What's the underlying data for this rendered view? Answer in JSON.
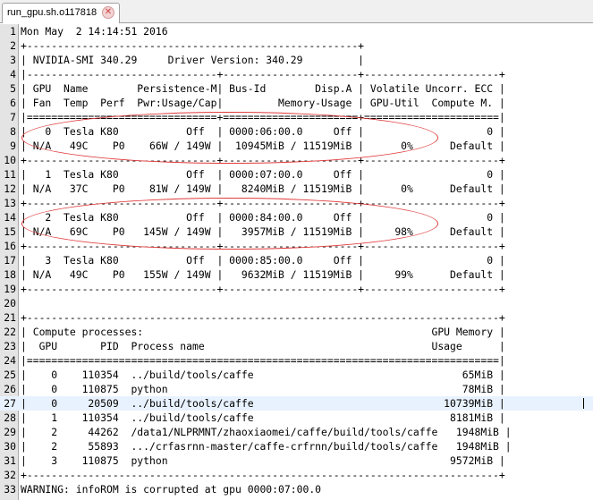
{
  "tab": {
    "title": "run_gpu.sh.o117818",
    "close_icon": "close-icon"
  },
  "editor": {
    "highlight_color": "#e8f2fe",
    "annotation_color": "#e03a3a",
    "current_line": 27,
    "lines": [
      "Mon May  2 14:14:51 2016",
      "+------------------------------------------------------+",
      "| NVIDIA-SMI 340.29     Driver Version: 340.29         |",
      "|-------------------------------+----------------------+----------------------+",
      "| GPU  Name        Persistence-M| Bus-Id        Disp.A | Volatile Uncorr. ECC |",
      "| Fan  Temp  Perf  Pwr:Usage/Cap|         Memory-Usage | GPU-Util  Compute M. |",
      "|===============================+======================+======================|",
      "|   0  Tesla K80           Off  | 0000:06:00.0     Off |                    0 |",
      "| N/A   49C    P0    66W / 149W |  10945MiB / 11519MiB |      0%      Default |",
      "+-------------------------------+----------------------+----------------------+",
      "|   1  Tesla K80           Off  | 0000:07:00.0     Off |                    0 |",
      "| N/A   37C    P0    81W / 149W |   8240MiB / 11519MiB |      0%      Default |",
      "+-------------------------------+----------------------+----------------------+",
      "|   2  Tesla K80           Off  | 0000:84:00.0     Off |                    0 |",
      "| N/A   69C    P0   145W / 149W |   3957MiB / 11519MiB |     98%      Default |",
      "+-------------------------------+----------------------+----------------------+",
      "|   3  Tesla K80           Off  | 0000:85:00.0     Off |                    0 |",
      "| N/A   49C    P0   155W / 149W |   9632MiB / 11519MiB |     99%      Default |",
      "+-------------------------------+----------------------+----------------------+",
      "",
      "+-----------------------------------------------------------------------------+",
      "| Compute processes:                                               GPU Memory |",
      "|  GPU       PID  Process name                                     Usage      |",
      "|=============================================================================|",
      "|    0    110354  ../build/tools/caffe                                  65MiB |",
      "|    0    110875  python                                                78MiB |",
      "|    0     20509  ../build/tools/caffe                               10739MiB |",
      "|    1    110354  ../build/tools/caffe                                8181MiB |",
      "|    2     44262  /data1/NLPRMNT/zhaoxiaomei/caffe/build/tools/caffe   1948MiB |",
      "|    2     55893  .../crfasrnn-master/caffe-crfrnn/build/tools/caffe   1948MiB |",
      "|    3    110875  python                                              9572MiB |",
      "+-----------------------------------------------------------------------------+",
      "WARNING: infoROM is corrupted at gpu 0000:07:00.0"
    ]
  }
}
